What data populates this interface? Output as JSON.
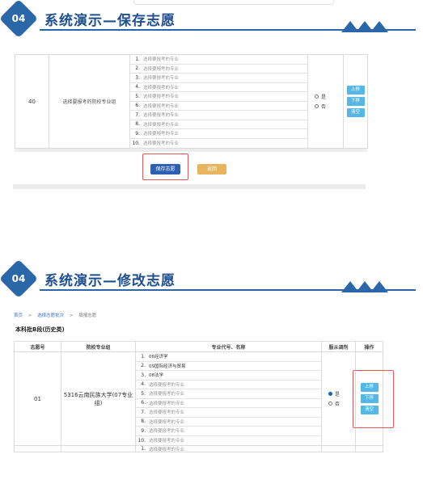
{
  "section1": {
    "badge": "04",
    "title": "系统演示—保存志愿"
  },
  "section2": {
    "badge": "04",
    "title": "系统演示—修改志愿"
  },
  "table1": {
    "number": "40",
    "group": "选择要报考的院校专业组",
    "options": [
      {
        "no": "1.",
        "text": "选择要报考的专业"
      },
      {
        "no": "2.",
        "text": "选择要报考的专业"
      },
      {
        "no": "3.",
        "text": "选择要报考的专业"
      },
      {
        "no": "4.",
        "text": "选择要报考的专业"
      },
      {
        "no": "5.",
        "text": "选择要报考的专业"
      },
      {
        "no": "6.",
        "text": "选择要报考的专业"
      },
      {
        "no": "7.",
        "text": "选择要报考的专业"
      },
      {
        "no": "8.",
        "text": "选择要报考的专业"
      },
      {
        "no": "9.",
        "text": "选择要报考的专业"
      },
      {
        "no": "10.",
        "text": "选择要报考的专业"
      }
    ],
    "radio_yes": "是",
    "radio_no": "否",
    "btn_up": "上移",
    "btn_down": "下移",
    "btn_clear": "清空"
  },
  "save_button": "保存志愿",
  "back_button": "返回",
  "breadcrumb": {
    "home": "首页",
    "sep1": ">",
    "select_batch": "选择志愿批次",
    "sep2": ">",
    "fill": "填报志愿"
  },
  "batch_title": "本科批B段(历史类)",
  "table2": {
    "headers": [
      "志愿号",
      "院校专业组",
      "专业代号、名称",
      "服从调剂",
      "操作"
    ],
    "number": "01",
    "group": "5316云南民族大学(07专业组)",
    "options": [
      {
        "no": "1.",
        "text": "06经济学",
        "filled": true
      },
      {
        "no": "2.",
        "text": "09国际经济与贸易",
        "filled": true
      },
      {
        "no": "3.",
        "text": "08法学",
        "filled": true
      },
      {
        "no": "4.",
        "text": "选择要报考的专业",
        "filled": false
      },
      {
        "no": "5.",
        "text": "选择要报考的专业",
        "filled": false
      },
      {
        "no": "6.",
        "text": "选择要报考的专业",
        "filled": false
      },
      {
        "no": "7.",
        "text": "选择要报考的专业",
        "filled": false
      },
      {
        "no": "8.",
        "text": "选择要报考的专业",
        "filled": false
      },
      {
        "no": "9.",
        "text": "选择要报考的专业",
        "filled": false
      },
      {
        "no": "10.",
        "text": "选择要报考的专业",
        "filled": false
      }
    ],
    "radio_yes": "是",
    "radio_no": "否",
    "btn_up": "上移",
    "btn_down": "下移",
    "btn_clear": "清空",
    "next_row_option": {
      "no": "1.",
      "text": "选择要报考的专业"
    }
  },
  "colors": {
    "brand": "#2a67a9",
    "action": "#55b7e6",
    "save": "#2f5fb1",
    "back": "#e9b45e",
    "highlight": "#e15a5a"
  }
}
